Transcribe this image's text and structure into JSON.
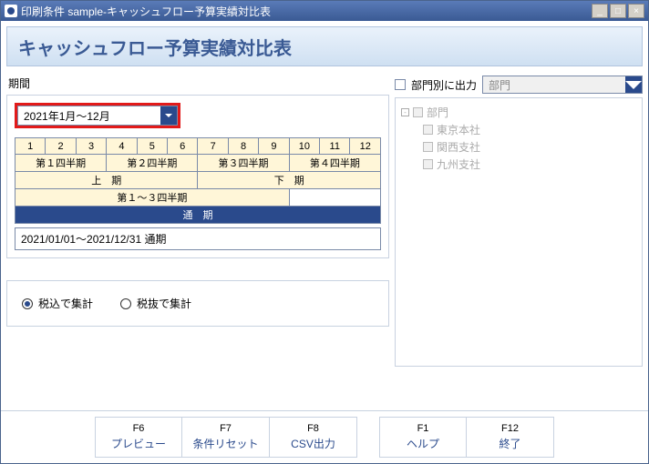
{
  "window": {
    "title": "印刷条件 sample-キャッシュフロー予算実績対比表"
  },
  "banner": {
    "title": "キャッシュフロー予算実績対比表"
  },
  "period": {
    "section_label": "期間",
    "combo_value": "2021年1月～12月",
    "months": [
      "1",
      "2",
      "3",
      "4",
      "5",
      "6",
      "7",
      "8",
      "9",
      "10",
      "11",
      "12"
    ],
    "quarters": [
      "第１四半期",
      "第２四半期",
      "第３四半期",
      "第４四半期"
    ],
    "halves": [
      "上　期",
      "下　期"
    ],
    "q123": "第１～３四半期",
    "full": "通　期",
    "readout": "2021/01/01～2021/12/31  通期"
  },
  "aggregate": {
    "incl_tax": "税込で集計",
    "excl_tax": "税抜で集計",
    "selected": "incl"
  },
  "dept": {
    "checkbox_label": "部門別に出力",
    "combo_value": "部門",
    "tree_root": "部門",
    "tree_children": [
      "東京本社",
      "関西支社",
      "九州支社"
    ]
  },
  "footer": {
    "f6": {
      "key": "F6",
      "label": "プレビュー"
    },
    "f7": {
      "key": "F7",
      "label": "条件リセット"
    },
    "f8": {
      "key": "F8",
      "label": "CSV出力"
    },
    "f1": {
      "key": "F1",
      "label": "ヘルプ"
    },
    "f12": {
      "key": "F12",
      "label": "終了"
    }
  }
}
